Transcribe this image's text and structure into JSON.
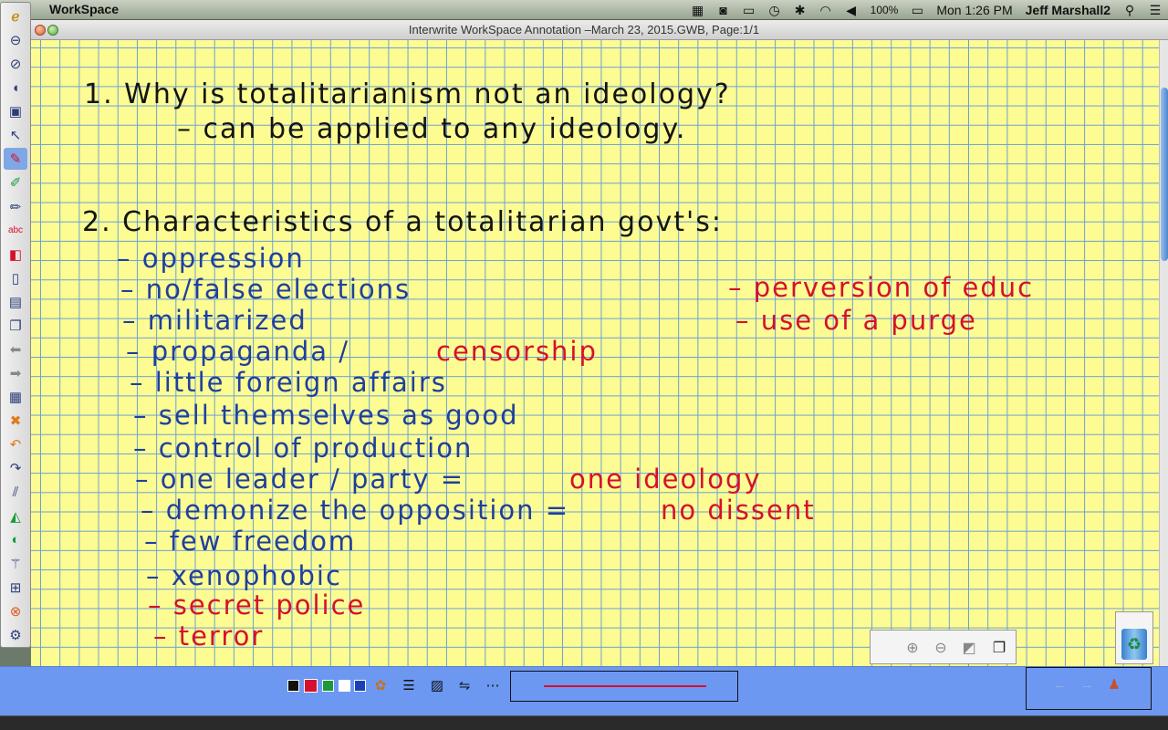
{
  "menubar": {
    "app_name": "WorkSpace",
    "battery": "100%",
    "clock": "Mon 1:26 PM",
    "user": "Jeff Marshall2"
  },
  "window": {
    "title": "Interwrite WorkSpace Annotation –March 23, 2015.GWB, Page:1/1"
  },
  "notes": {
    "q1_title": "1. Why is totalitarianism not an ideology?",
    "q1_answer": "– can be applied to any ideology.",
    "q2_title": "2. Characteristics of a totalitarian govt's:",
    "items_blue": [
      "– oppression",
      "– no/false elections",
      "– militarized",
      "– propaganda /",
      "– little foreign affairs",
      "– sell themselves as good",
      "– control of production",
      "– one leader / party =",
      "– demonize the opposition =",
      "– few freedom",
      "– xenophobic"
    ],
    "items_red_inline": [
      "censorship",
      "one ideology",
      "no dissent"
    ],
    "items_red": [
      "– secret police",
      "– terror"
    ],
    "items_red_right": [
      "– perversion of educ",
      "– use of a purge"
    ]
  },
  "palette": {
    "colors": [
      "#111111",
      "#d5102e",
      "#1a9a3a",
      "#ffffff",
      "#1f3fb8"
    ],
    "canvas_color": "#fcfc92",
    "grid_color": "#6b9fd6"
  },
  "icons": {
    "toolbar": [
      "logo-icon",
      "minimize-icon",
      "float-icon",
      "mouse-icon",
      "save-icon",
      "select-icon",
      "pen-icon",
      "highlighter-icon",
      "pencil-icon",
      "text-recognition-icon",
      "eraser-icon",
      "new-page-icon",
      "page-list-icon",
      "copy-page-icon",
      "back-icon",
      "forward-icon",
      "spreadsheet-icon",
      "clear-icon",
      "undo-icon",
      "redo-icon",
      "lines-icon",
      "shapes-icon",
      "spotlight-icon",
      "magic-wand-icon",
      "screen-capture-icon",
      "close-icon",
      "settings-icon"
    ]
  }
}
